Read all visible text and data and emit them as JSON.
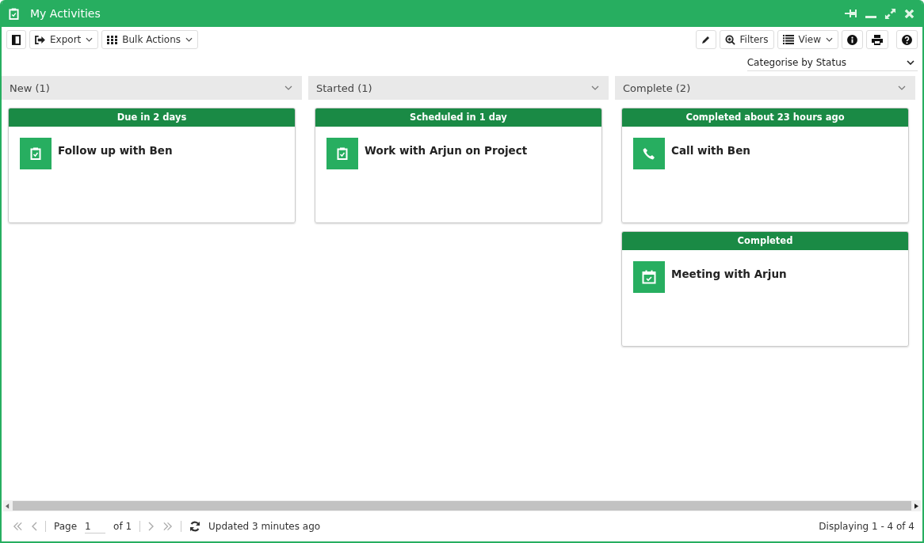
{
  "window": {
    "title": "My Activities"
  },
  "toolbar": {
    "left": [
      {
        "kind": "panel"
      },
      {
        "kind": "export",
        "label": "Export"
      },
      {
        "kind": "bulk",
        "label": "Bulk Actions"
      }
    ],
    "right": [
      {
        "kind": "edit"
      },
      {
        "kind": "filters",
        "label": "Filters"
      },
      {
        "kind": "view",
        "label": "View"
      },
      {
        "kind": "info"
      },
      {
        "kind": "print"
      },
      {
        "kind": "help"
      }
    ]
  },
  "categorise": {
    "value": "Categorise by Status"
  },
  "columns": [
    {
      "title": "New (1)",
      "cards": [
        {
          "kind": "task",
          "header": "Due in 2 days",
          "title": "Follow up with Ben"
        }
      ]
    },
    {
      "title": "Started (1)",
      "cards": [
        {
          "kind": "task",
          "header": "Scheduled in 1 day",
          "title": "Work with Arjun on Project"
        }
      ]
    },
    {
      "title": "Complete (2)",
      "cards": [
        {
          "kind": "call",
          "header": "Completed about 23 hours ago",
          "title": "Call with Ben"
        },
        {
          "kind": "meeting",
          "header": "Completed",
          "title": "Meeting with Arjun"
        }
      ]
    }
  ],
  "pager": {
    "page_label": "Page",
    "page": "1",
    "of": "of 1",
    "updated": "Updated 3 minutes ago",
    "displaying": "Displaying 1 - 4 of 4"
  }
}
